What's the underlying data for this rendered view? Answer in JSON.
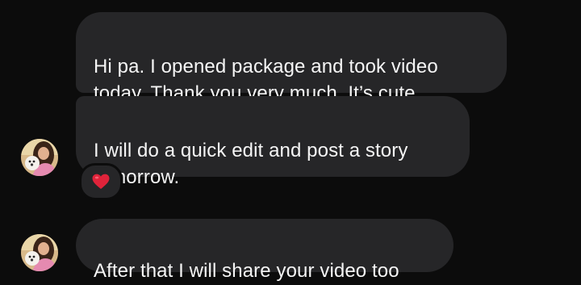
{
  "messages": [
    {
      "text": "Hi pa.  I opened package and took video\ntoday.  Thank you very much. It’s cute"
    },
    {
      "text": "I will do a quick edit and post a story\ntomorrow.",
      "reaction": "heart-emoji"
    },
    {
      "text": "After that I will share your video too"
    }
  ],
  "colors": {
    "background": "#0c0c0c",
    "bubble": "#262628",
    "text": "#f5f5f5",
    "heart": "#e0233a"
  },
  "icons": {
    "reaction": "heart-icon",
    "avatar": "contact-avatar"
  }
}
